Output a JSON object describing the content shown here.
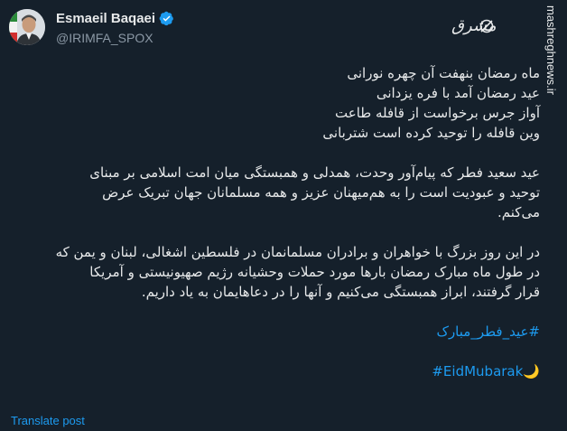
{
  "author": {
    "display_name": "Esmaeil Baqaei",
    "handle": "@IRIMFA_SPOX",
    "verified_color": "#1d9bf0"
  },
  "watermark": {
    "site": "mashreghnews.ir",
    "brand_logo": "مشرق"
  },
  "tweet": {
    "poem": [
      "ماه رمضان بنهفت آن چهره نورانی",
      "عید رمضان آمد با فره یزدانی",
      "آواز جرس برخواست از قافله طاعت",
      "وین قافله را توحید کرده است شتربانی"
    ],
    "para2": [
      "عید سعید فطر که پیام‌آور وحدت، همدلی و همبستگی میان امت اسلامی بر مبنای",
      "توحید و عبودیت است را به هم‌میهنان عزیز و همه مسلمانان جهان تبریک عرض",
      "می‌کنم."
    ],
    "para3": [
      "در این روز بزرگ با خواهران و برادران مسلمانمان در فلسطین اشغالی، لبنان و یمن که",
      "در طول ماه مبارک رمضان بارها مورد حملات وحشیانه رژیم صهیونیستی و آمریکا",
      "قرار گرفتند، ابراز همبستگی می‌کنیم و آنها را در دعاهایمان به یاد داریم."
    ],
    "hashtag_fa": "#عید_فطر_مبارک",
    "hashtag_en": "#EidMubarak",
    "emoji": "🌙"
  },
  "actions": {
    "translate": "Translate post"
  },
  "colors": {
    "background": "#15202b",
    "text": "#e7e9ea",
    "muted": "#8b98a5",
    "link": "#1d9bf0"
  }
}
